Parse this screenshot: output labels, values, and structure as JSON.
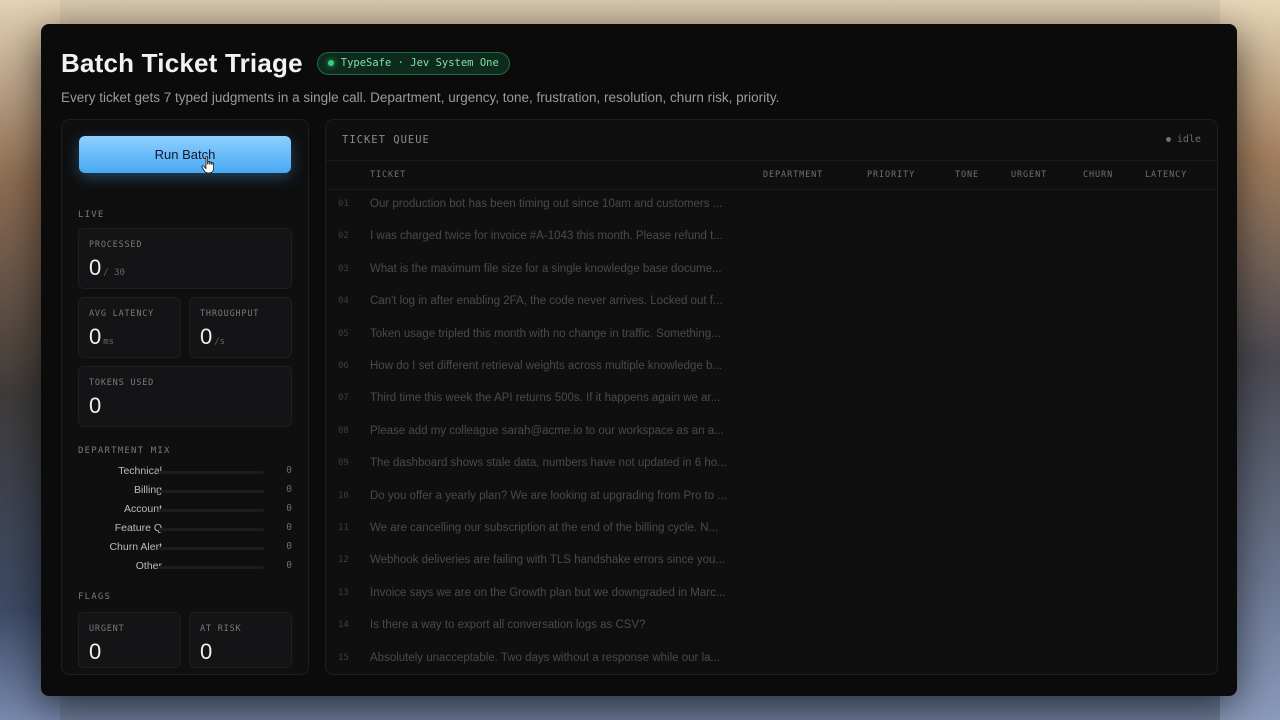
{
  "header": {
    "title": "Batch Ticket Triage",
    "badge": "TypeSafe · Jev System One",
    "subtitle": "Every ticket gets 7 typed judgments in a single call. Department, urgency, tone, frustration, resolution, churn risk, priority."
  },
  "sidebar": {
    "run_label": "Run Batch",
    "live_label": "LIVE",
    "processed": {
      "label": "PROCESSED",
      "value": "0",
      "unit": "/ 30"
    },
    "avg_latency": {
      "label": "AVG LATENCY",
      "value": "0",
      "unit": "ms"
    },
    "throughput": {
      "label": "THROUGHPUT",
      "value": "0",
      "unit": "/s"
    },
    "tokens": {
      "label": "TOKENS USED",
      "value": "0"
    },
    "dept_label": "DEPARTMENT MIX",
    "departments": [
      {
        "name": "Technical",
        "count": "0"
      },
      {
        "name": "Billing",
        "count": "0"
      },
      {
        "name": "Account",
        "count": "0"
      },
      {
        "name": "Feature Q",
        "count": "0"
      },
      {
        "name": "Churn Alert",
        "count": "0"
      },
      {
        "name": "Other",
        "count": "0"
      }
    ],
    "flags_label": "FLAGS",
    "urgent": {
      "label": "URGENT",
      "value": "0"
    },
    "at_risk": {
      "label": "AT RISK",
      "value": "0"
    }
  },
  "queue": {
    "title": "TICKET QUEUE",
    "status": "idle",
    "columns": {
      "ticket": "TICKET",
      "department": "DEPARTMENT",
      "priority": "PRIORITY",
      "tone": "TONE",
      "urgent": "URGENT",
      "churn": "CHURN",
      "latency": "LATENCY"
    },
    "rows": [
      {
        "num": "01",
        "text": "Our production bot has been timing out since 10am and customers ..."
      },
      {
        "num": "02",
        "text": "I was charged twice for invoice #A-1043 this month. Please refund t..."
      },
      {
        "num": "03",
        "text": "What is the maximum file size for a single knowledge base docume..."
      },
      {
        "num": "04",
        "text": "Can't log in after enabling 2FA, the code never arrives. Locked out f..."
      },
      {
        "num": "05",
        "text": "Token usage tripled this month with no change in traffic. Something..."
      },
      {
        "num": "06",
        "text": "How do I set different retrieval weights across multiple knowledge b..."
      },
      {
        "num": "07",
        "text": "Third time this week the API returns 500s. If it happens again we ar..."
      },
      {
        "num": "08",
        "text": "Please add my colleague sarah@acme.io to our workspace as an a..."
      },
      {
        "num": "09",
        "text": "The dashboard shows stale data, numbers have not updated in 6 ho..."
      },
      {
        "num": "10",
        "text": "Do you offer a yearly plan? We are looking at upgrading from Pro to ..."
      },
      {
        "num": "11",
        "text": "We are cancelling our subscription at the end of the billing cycle. N..."
      },
      {
        "num": "12",
        "text": "Webhook deliveries are failing with TLS handshake errors since you..."
      },
      {
        "num": "13",
        "text": "Invoice says we are on the Growth plan but we downgraded in Marc..."
      },
      {
        "num": "14",
        "text": "Is there a way to export all conversation logs as CSV?"
      },
      {
        "num": "15",
        "text": "Absolutely unacceptable. Two days without a response while our la..."
      }
    ]
  }
}
